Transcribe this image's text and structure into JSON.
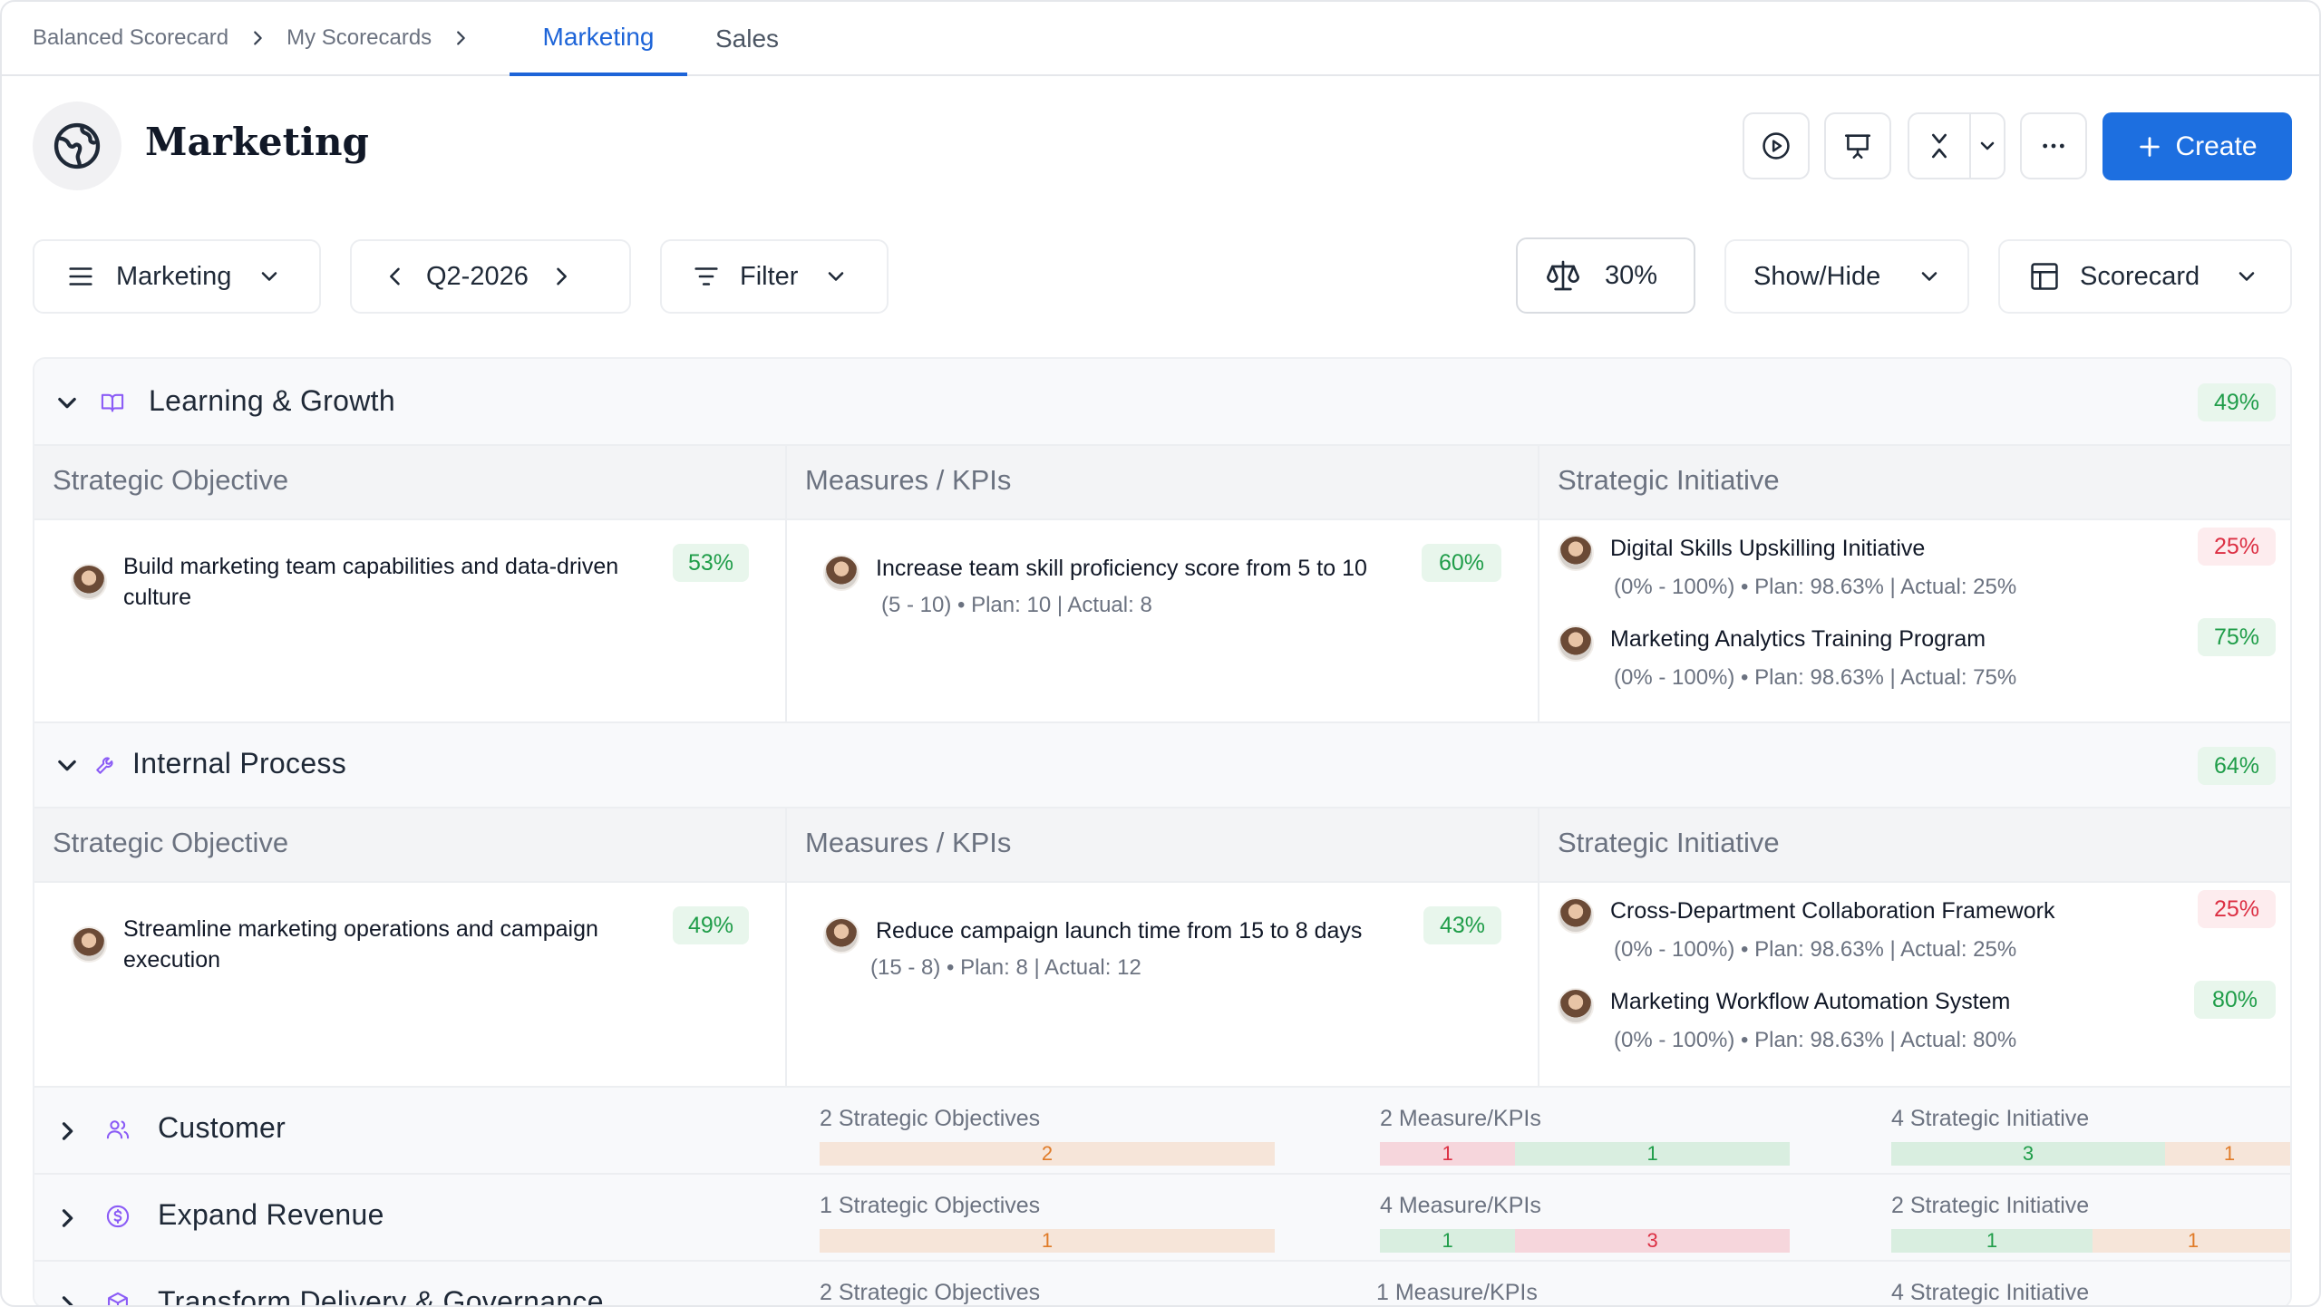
{
  "breadcrumb": {
    "items": [
      "Balanced Scorecard",
      "My Scorecards"
    ],
    "tabs": [
      "Marketing",
      "Sales"
    ],
    "active_tab": "Marketing"
  },
  "header": {
    "title": "Marketing",
    "create_label": "Create",
    "icons": [
      "globe-icon",
      "play-icon",
      "presentation-icon",
      "collapse-icon",
      "chevron-down-icon",
      "more-icon",
      "plus-icon"
    ]
  },
  "toolbar": {
    "scorecard_select": "Marketing",
    "period": "Q2-2026",
    "filter_label": "Filter",
    "weight_value": "30%",
    "show_hide_label": "Show/Hide",
    "view_label": "Scorecard"
  },
  "colors": {
    "accent": "#1d6fe0",
    "green": "#1f9d49",
    "red": "#dc2f43",
    "orange": "#e07b28"
  },
  "perspectives": [
    {
      "name": "Learning & Growth",
      "icon": "book-icon",
      "score": "49%",
      "headers": [
        "Strategic Objective",
        "Measures / KPIs",
        "Strategic Initiative"
      ],
      "objective": {
        "text": "Build marketing team capabilities and data-driven culture",
        "score": "53%"
      },
      "kpi": {
        "text": "Increase team skill proficiency score from 5 to 10",
        "detail": "(5 - 10) • Plan: 10 | Actual: 8",
        "score": "60%"
      },
      "initiatives": [
        {
          "name": "Digital Skills Upskilling Initiative",
          "detail": "(0% - 100%) • Plan: 98.63% | Actual: 25%",
          "score": "25%",
          "status": "red"
        },
        {
          "name": "Marketing Analytics Training Program",
          "detail": "(0% - 100%) • Plan: 98.63% | Actual: 75%",
          "score": "75%",
          "status": "green"
        }
      ]
    },
    {
      "name": "Internal Process",
      "icon": "wrench-icon",
      "score": "64%",
      "headers": [
        "Strategic Objective",
        "Measures / KPIs",
        "Strategic Initiative"
      ],
      "objective": {
        "text": "Streamline marketing operations and campaign execution",
        "score": "49%"
      },
      "kpi": {
        "text": "Reduce campaign launch time from 15 to 8 days",
        "detail": "(15 - 8) • Plan: 8 |  Actual: 12",
        "score": "43%"
      },
      "initiatives": [
        {
          "name": "Cross-Department Collaboration Framework",
          "detail": "(0% - 100%) • Plan: 98.63% | Actual: 25%",
          "score": "25%",
          "status": "red"
        },
        {
          "name": "Marketing Workflow Automation System",
          "detail": "(0% - 100%) • Plan: 98.63% | Actual: 80%",
          "score": "80%",
          "status": "green"
        }
      ]
    }
  ],
  "collapsed": [
    {
      "name": "Customer",
      "icon": "users-icon",
      "objectives_label": "2 Strategic Objectives",
      "objectives_bar": [
        {
          "value": "2",
          "color": "o",
          "share": 1.0
        }
      ],
      "measures_label": "2 Measure/KPIs",
      "measures_bar": [
        {
          "value": "1",
          "color": "r",
          "share": 0.33
        },
        {
          "value": "1",
          "color": "g",
          "share": 0.67
        }
      ],
      "initiatives_label": "4 Strategic Initiative",
      "initiatives_bar": [
        {
          "value": "3",
          "color": "g",
          "share": 0.68
        },
        {
          "value": "1",
          "color": "o",
          "share": 0.32
        }
      ]
    },
    {
      "name": "Expand Revenue",
      "icon": "dollar-icon",
      "objectives_label": "1 Strategic Objectives",
      "objectives_bar": [
        {
          "value": "1",
          "color": "o",
          "share": 1.0
        }
      ],
      "measures_label": "4 Measure/KPIs",
      "measures_bar": [
        {
          "value": "1",
          "color": "g",
          "share": 0.33
        },
        {
          "value": "3",
          "color": "r",
          "share": 0.67
        }
      ],
      "initiatives_label": "2 Strategic Initiative",
      "initiatives_bar": [
        {
          "value": "1",
          "color": "g",
          "share": 0.5
        },
        {
          "value": "1",
          "color": "o",
          "share": 0.5
        }
      ]
    },
    {
      "name": "Transform Delivery & Governance",
      "icon": "box-icon",
      "objectives_label": "2 Strategic Objectives",
      "measures_label": "1 Measure/KPIs",
      "initiatives_label": "4 Strategic Initiative"
    }
  ]
}
